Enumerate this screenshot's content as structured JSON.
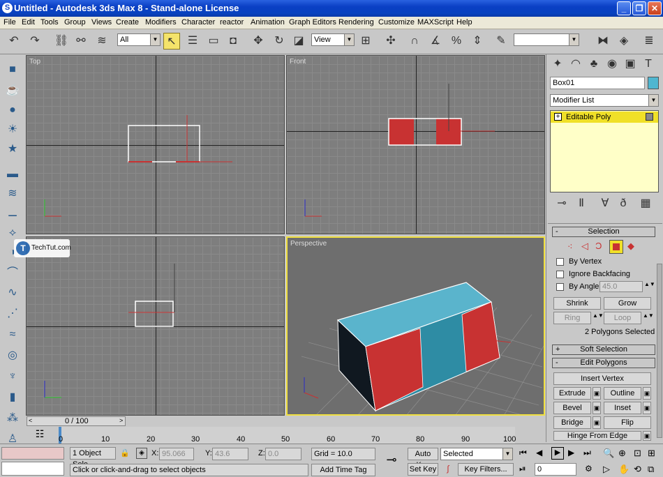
{
  "titlebar": {
    "title": "Untitled - Autodesk 3ds Max 8  - Stand-alone License",
    "minimize": "_",
    "restore": "❐",
    "close": "✕"
  },
  "menu": [
    "File",
    "Edit",
    "Tools",
    "Group",
    "Views",
    "Create",
    "Modifiers",
    "Character",
    "reactor",
    "Animation",
    "Graph Editors",
    "Rendering",
    "Customize",
    "MAXScript",
    "Help"
  ],
  "toolbar": {
    "selection_filter": "All",
    "reference_coord": "View",
    "named_selection": ""
  },
  "viewports": {
    "top": "Top",
    "front": "Front",
    "left": "",
    "perspective": "Perspective"
  },
  "watermark": {
    "text": "TechTut.com"
  },
  "command_panel": {
    "object_name": "Box01",
    "object_color": "#4fb6d0",
    "modifier_list": "Modifier List",
    "stack_item": "Editable Poly",
    "selection_rollup": "Selection",
    "by_vertex": "By Vertex",
    "ignore_backfacing": "Ignore Backfacing",
    "by_angle": "By Angle:",
    "by_angle_value": "45.0",
    "shrink": "Shrink",
    "grow": "Grow",
    "ring": "Ring",
    "loop": "Loop",
    "selection_status": "2 Polygons Selected",
    "soft_selection": "Soft Selection",
    "edit_polygons": "Edit Polygons",
    "insert_vertex": "Insert Vertex",
    "extrude": "Extrude",
    "outline": "Outline",
    "bevel": "Bevel",
    "inset": "Inset",
    "bridge": "Bridge",
    "flip": "Flip",
    "hinge": "Hinge From Edge",
    "minus": "-",
    "plus": "+"
  },
  "timeline": {
    "frame": "0 / 100",
    "ticks": [
      "0",
      "10",
      "20",
      "30",
      "40",
      "50",
      "60",
      "70",
      "80",
      "90",
      "100"
    ]
  },
  "status": {
    "selection": "1 Object Sele",
    "x_label": "X:",
    "x_value": "95.066",
    "y_label": "Y:",
    "y_value": "43.6",
    "z_label": "Z:",
    "z_value": "0.0",
    "grid": "Grid = 10.0",
    "prompt": "Click or click-and-drag to select objects",
    "add_time_tag": "Add Time Tag",
    "auto_key": "Auto Key",
    "set_key": "Set Key",
    "key_mode": "Selected",
    "key_filters": "Key Filters...",
    "current_frame": "0"
  },
  "colors": {
    "selected_poly": "#c83232",
    "box_top": "#5ab4cc",
    "viewport_bg": "#7e7e7e",
    "active_border": "#f0e040"
  }
}
